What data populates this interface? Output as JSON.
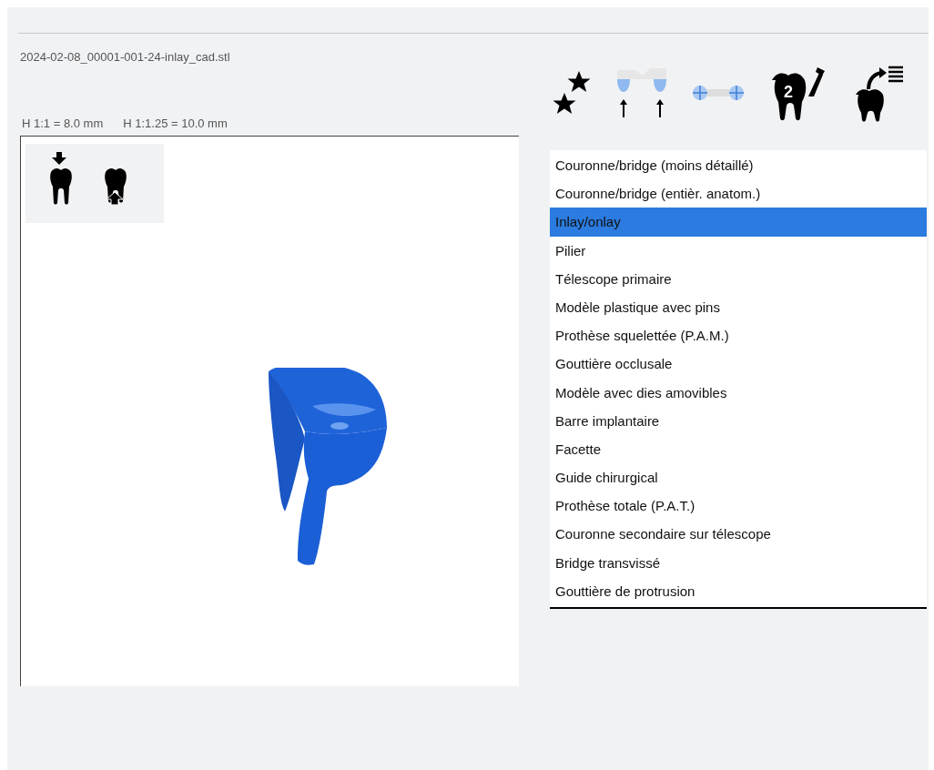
{
  "file_name": "2024-02-08_00001-001-24-inlay_cad.stl",
  "scale_labels": [
    "H 1:1 = 8.0 mm",
    "H 1:1.25 = 10.0 mm"
  ],
  "toolbar": {
    "tooth_number": "2"
  },
  "restoration_types": [
    {
      "label": "Couronne/bridge (moins détaillé)",
      "selected": false
    },
    {
      "label": "Couronne/bridge (entièr. anatom.)",
      "selected": false
    },
    {
      "label": "Inlay/onlay",
      "selected": true
    },
    {
      "label": "Pilier",
      "selected": false
    },
    {
      "label": "Télescope primaire",
      "selected": false
    },
    {
      "label": "Modèle plastique avec pins",
      "selected": false
    },
    {
      "label": "Prothèse squelettée (P.A.M.)",
      "selected": false
    },
    {
      "label": "Gouttière occlusale",
      "selected": false
    },
    {
      "label": "Modèle avec dies amovibles",
      "selected": false
    },
    {
      "label": "Barre implantaire",
      "selected": false
    },
    {
      "label": "Facette",
      "selected": false
    },
    {
      "label": "Guide chirurgical",
      "selected": false
    },
    {
      "label": "Prothèse totale (P.A.T.)",
      "selected": false
    },
    {
      "label": "Couronne secondaire sur télescope",
      "selected": false
    },
    {
      "label": "Bridge transvissé",
      "selected": false
    },
    {
      "label": "Gouttière de protrusion",
      "selected": false
    }
  ]
}
